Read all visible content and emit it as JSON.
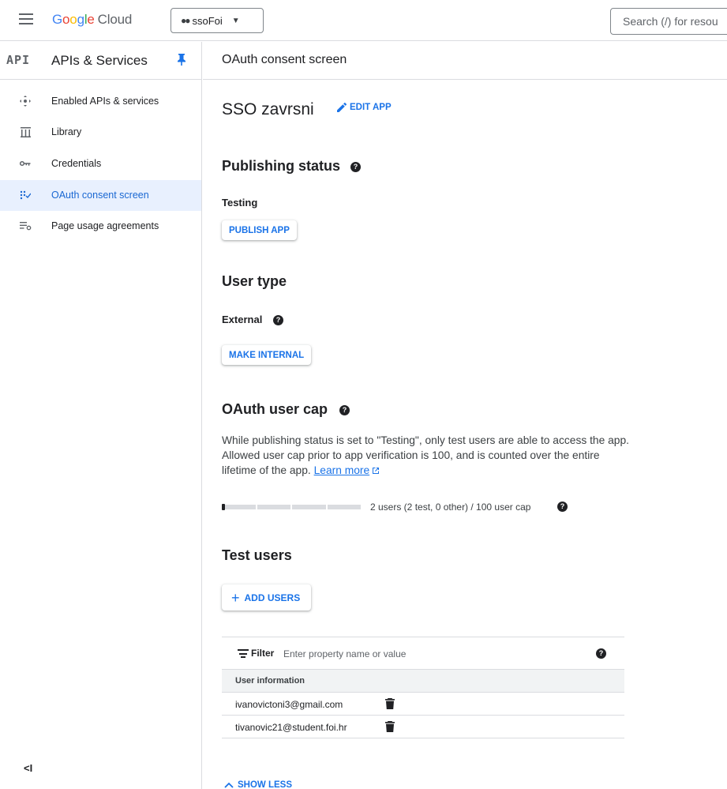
{
  "topbar": {
    "logo_letters": [
      "G",
      "o",
      "o",
      "g",
      "l",
      "e"
    ],
    "logo_cloud": "Cloud",
    "project": "ssoFoi",
    "search_placeholder": "Search (/) for resou"
  },
  "sidebar": {
    "api_badge": "API",
    "title": "APIs & Services",
    "items": [
      {
        "label": "Enabled APIs & services",
        "icon": "enabled-apis-icon"
      },
      {
        "label": "Library",
        "icon": "library-icon"
      },
      {
        "label": "Credentials",
        "icon": "key-icon"
      },
      {
        "label": "OAuth consent screen",
        "icon": "oauth-icon",
        "active": true
      },
      {
        "label": "Page usage agreements",
        "icon": "settings-list-icon"
      }
    ],
    "collapse_label": "<I"
  },
  "main": {
    "header": "OAuth consent screen",
    "app_name": "SSO zavrsni",
    "edit_app": "EDIT APP",
    "publishing": {
      "heading": "Publishing status",
      "status": "Testing",
      "button": "PUBLISH APP"
    },
    "user_type": {
      "heading": "User type",
      "value": "External",
      "button": "MAKE INTERNAL"
    },
    "user_cap": {
      "heading": "OAuth user cap",
      "description": "While publishing status is set to \"Testing\", only test users are able to access the app. Allowed user cap prior to app verification is 100, and is counted over the entire lifetime of the app.",
      "learn_more": "Learn more",
      "usage_text": "2 users (2 test, 0 other) / 100 user cap",
      "usage_fraction": 0.02
    },
    "test_users": {
      "heading": "Test users",
      "add_button": "ADD USERS",
      "filter_label": "Filter",
      "filter_placeholder": "Enter property name or value",
      "column_header": "User information",
      "rows": [
        {
          "email": "ivanovictoni3@gmail.com"
        },
        {
          "email": "tivanovic21@student.foi.hr"
        }
      ]
    },
    "show_less": "SHOW LESS"
  },
  "colors": {
    "accent": "#1a73e8",
    "active_bg": "#e8f0fe",
    "border": "#dadce0"
  }
}
